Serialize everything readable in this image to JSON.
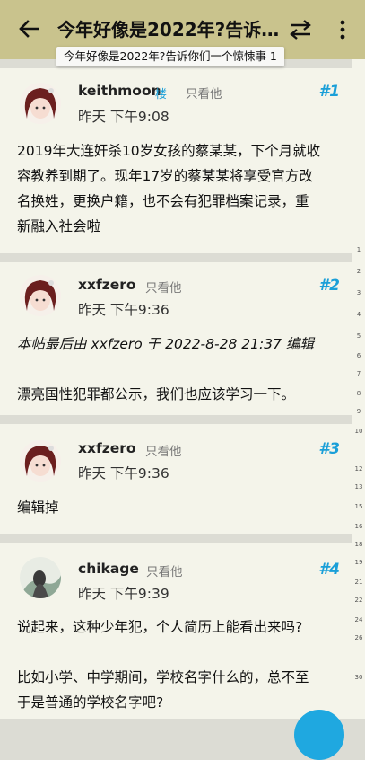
{
  "appbar": {
    "title": "今年好像是2022年?告诉你们一个惊悚事",
    "back_icon": "back-arrow-icon",
    "swap_icon": "swap-arrows-icon",
    "more_icon": "more-vertical-icon"
  },
  "tooltip": {
    "text": "今年好像是2022年?告诉你们一个惊悚事 1"
  },
  "posts": [
    {
      "username": "keithmoon",
      "op_badge": "楼",
      "only_label": "只看他",
      "floor": "#1",
      "time": "昨天 下午9:08",
      "lines": [
        "2019年大连奸杀10岁女孩的蔡某某，下个月就收",
        "容教养到期了。现年17岁的蔡某某将享受官方改",
        "名换姓，更换户籍，也不会有犯罪档案记录，重",
        "新融入社会啦"
      ]
    },
    {
      "username": "xxfzero",
      "only_label": "只看他",
      "floor": "#2",
      "time": "昨天 下午9:36",
      "edited": "本帖最后由 xxfzero 于 2022-8-28 21:37 编辑",
      "lines": [
        "漂亮国性犯罪都公示，我们也应该学习一下。"
      ]
    },
    {
      "username": "xxfzero",
      "only_label": "只看他",
      "floor": "#3",
      "time": "昨天 下午9:36",
      "lines": [
        "编辑掉"
      ]
    },
    {
      "username": "chikage",
      "only_label": "只看他",
      "floor": "#4",
      "time": "昨天 下午9:39",
      "lines": [
        "说起来，这种少年犯，个人简历上能看出来吗?",
        "",
        "比如小学、中学期间，学校名字什么的，总不至",
        "于是普通的学校名字吧?"
      ]
    }
  ],
  "page_scale": [
    "1",
    "2",
    "3",
    "4",
    "5",
    "6",
    "7",
    "8",
    "9",
    "10",
    "12",
    "13",
    "15",
    "16",
    "18",
    "19",
    "21",
    "22",
    "24",
    "26",
    "30"
  ],
  "colors": {
    "appbar": "#c9c38d",
    "accent": "#1a9fd8",
    "card": "#f4f4ea"
  }
}
